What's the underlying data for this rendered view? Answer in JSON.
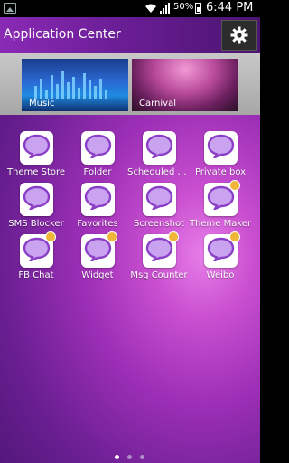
{
  "status_bar": {
    "battery_percent": "50%",
    "time": "6:44 PM"
  },
  "header": {
    "title": "Application Center",
    "settings_icon": "gear-icon"
  },
  "banners": [
    {
      "label": "Music"
    },
    {
      "label": "Carnival"
    }
  ],
  "apps": [
    {
      "label": "Theme Store",
      "badge": false
    },
    {
      "label": "Folder",
      "badge": false
    },
    {
      "label": "Scheduled m...",
      "badge": false
    },
    {
      "label": "Private box",
      "badge": false
    },
    {
      "label": "SMS Blocker",
      "badge": false
    },
    {
      "label": "Favorites",
      "badge": false
    },
    {
      "label": "Screenshot",
      "badge": false
    },
    {
      "label": "Theme Maker",
      "badge": true
    },
    {
      "label": "FB Chat",
      "badge": true
    },
    {
      "label": "Widget",
      "badge": true
    },
    {
      "label": "Msg Counter",
      "badge": true
    },
    {
      "label": "Weibo",
      "badge": true
    }
  ],
  "page_indicator": {
    "pages": 3,
    "current": 1
  },
  "colors": {
    "accent": "#9c2fb6",
    "bubble_fill": "#c9a3f0",
    "bubble_stroke": "#8b3fc7",
    "badge": "#f0b63a"
  }
}
